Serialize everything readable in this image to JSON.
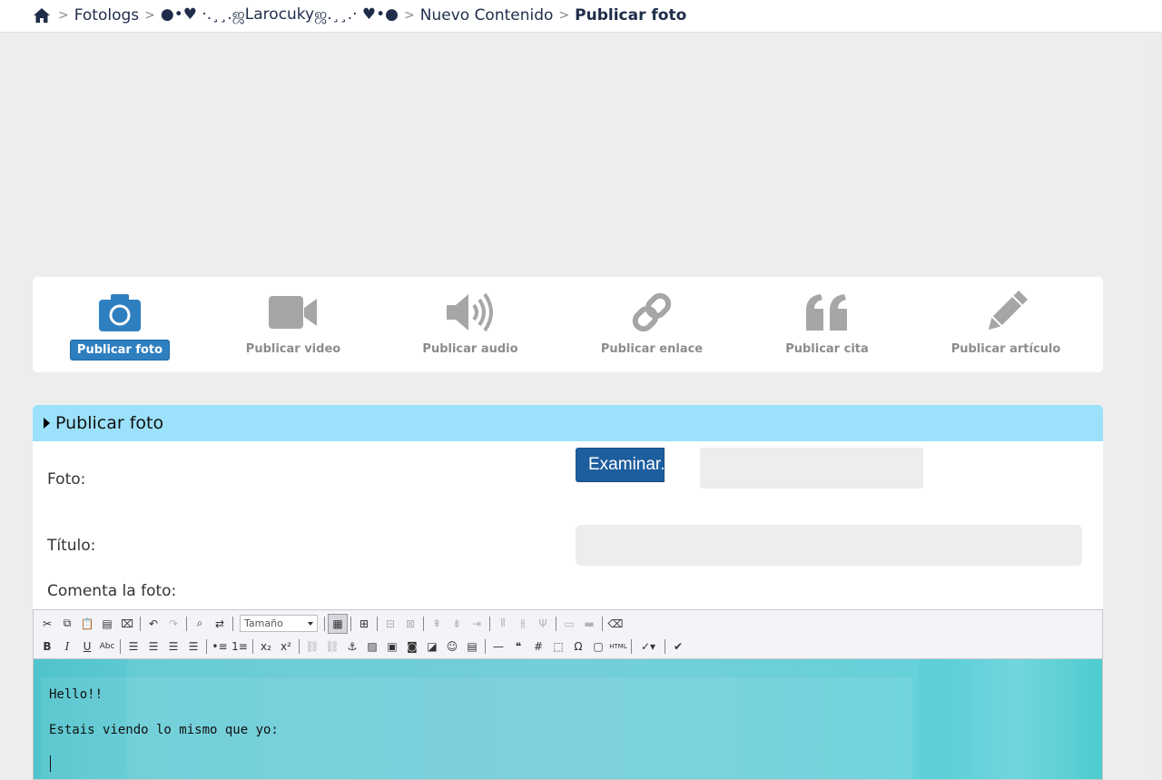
{
  "breadcrumb": {
    "items": [
      "Fotologs",
      "●•♥ ·.¸¸.ஜLarocukyஜ.¸¸.· ♥•●",
      "Nuevo Contenido"
    ],
    "current": "Publicar foto"
  },
  "content_types": [
    {
      "label": "Publicar foto",
      "icon": "camera-icon",
      "active": true
    },
    {
      "label": "Publicar video",
      "icon": "video-icon",
      "active": false
    },
    {
      "label": "Publicar audio",
      "icon": "volume-icon",
      "active": false
    },
    {
      "label": "Publicar enlace",
      "icon": "link-icon",
      "active": false
    },
    {
      "label": "Publicar cita",
      "icon": "quote-icon",
      "active": false
    },
    {
      "label": "Publicar artículo",
      "icon": "pencil-icon",
      "active": false
    }
  ],
  "form": {
    "section_title": "Publicar foto",
    "photo_label": "Foto:",
    "browse_button": "Examinar...",
    "title_label": "Título:",
    "comment_label": "Comenta la foto:"
  },
  "toolbar": {
    "size_select_value": "Tamaño",
    "bold": "B",
    "italic": "I",
    "underline": "U",
    "strike": "Abc",
    "subscript": "x₂",
    "superscript": "x²",
    "hash": "#",
    "omega": "Ω",
    "html": "HTML"
  },
  "editor": {
    "line1": "Hello!!",
    "line2": "Estais viendo lo mismo que yo:"
  },
  "colors": {
    "active_accent": "#2e7fc0",
    "panel_header": "#9ce1fb",
    "browse_button": "#1d5e9e",
    "inactive_icon": "#a6a6a6",
    "editor_background": "#5fc9d4"
  }
}
